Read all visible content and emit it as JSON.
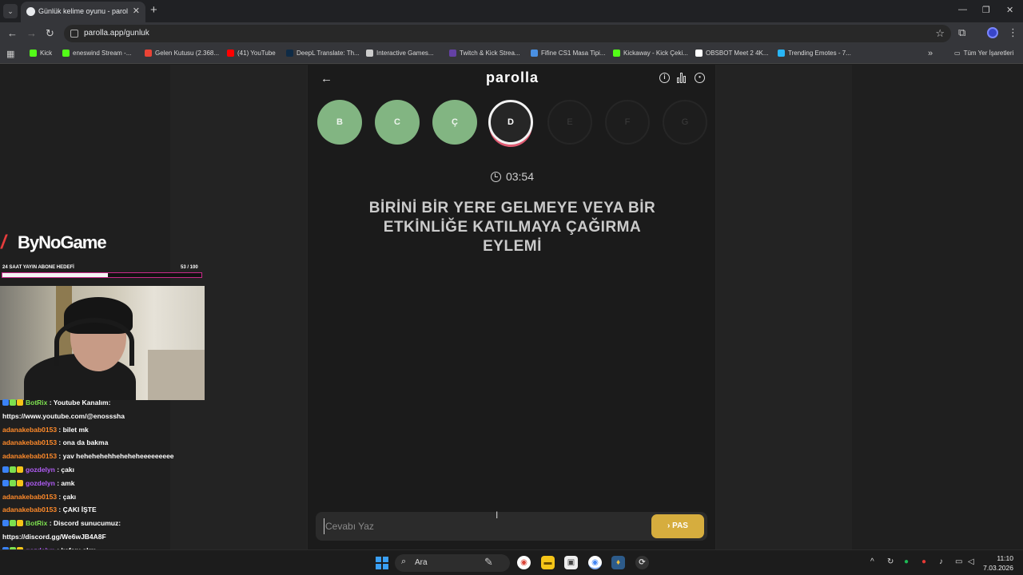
{
  "browser": {
    "tab_title": "Günlük kelime oyunu - parolla",
    "url": "parolla.app/gunluk",
    "bookmarks": [
      {
        "label": "Kick",
        "color": "#53fc18"
      },
      {
        "label": "eneswind Stream -...",
        "color": "#53fc18"
      },
      {
        "label": "Gelen Kutusu (2.368...",
        "color": "#ea4335"
      },
      {
        "label": "(41) YouTube",
        "color": "#ff0000"
      },
      {
        "label": "DeepL Translate: Th...",
        "color": "#0f2b46"
      },
      {
        "label": "Interactive Games...",
        "color": "#cccccc"
      },
      {
        "label": "Twitch & Kick Strea...",
        "color": "#6441a5"
      },
      {
        "label": "Fifine CS1 Masa Tipi...",
        "color": "#4a90e2"
      },
      {
        "label": "Kickaway - Kick Çeki...",
        "color": "#53fc18"
      },
      {
        "label": "OBSBOT Meet 2 4K...",
        "color": "#ffffff"
      },
      {
        "label": "Trending Emotes - 7...",
        "color": "#29b6f6"
      }
    ],
    "all_bookmarks": "Tüm Yer İşaretleri"
  },
  "game": {
    "logo": "parolla",
    "letters": [
      {
        "letter": "B",
        "state": "done"
      },
      {
        "letter": "C",
        "state": "done"
      },
      {
        "letter": "Ç",
        "state": "done"
      },
      {
        "letter": "D",
        "state": "current"
      },
      {
        "letter": "E",
        "state": "future"
      },
      {
        "letter": "F",
        "state": "future"
      },
      {
        "letter": "G",
        "state": "future"
      }
    ],
    "timer": "03:54",
    "question": "BİRİNİ BİR YERE GELMEYE VEYA BİR ETKİNLİĞE KATILMAYA ÇAĞIRMA EYLEMİ",
    "answer_placeholder": "Cevabı Yaz",
    "pass_label": "PAS"
  },
  "overlay": {
    "brand": "ByNoGame",
    "goal_label": "24 SAAT YAYIN ABONE HEDEFİ",
    "goal_count": "53 / 100",
    "goal_progress": 0.53,
    "chat": [
      {
        "user": "BotRix",
        "user_color": "green",
        "badges": true,
        "text": ": Youtube Kanalım:"
      },
      {
        "user": "",
        "user_color": "",
        "badges": false,
        "text": "https://www.youtube.com/@enosssha"
      },
      {
        "user": "adanakebab0153",
        "user_color": "orange",
        "badges": false,
        "text": ": bilet mk"
      },
      {
        "user": "adanakebab0153",
        "user_color": "orange",
        "badges": false,
        "text": ": ona da bakma"
      },
      {
        "user": "adanakebab0153",
        "user_color": "orange",
        "badges": false,
        "text": ": yav hehehehehheheheheeeeeeeee"
      },
      {
        "user": "gozdelyn",
        "user_color": "purple",
        "badges": true,
        "text": ": çakı"
      },
      {
        "user": "gozdelyn",
        "user_color": "purple",
        "badges": true,
        "text": ": amk"
      },
      {
        "user": "adanakebab0153",
        "user_color": "orange",
        "badges": false,
        "text": ": çakı"
      },
      {
        "user": "adanakebab0153",
        "user_color": "orange",
        "badges": false,
        "text": ": ÇAKI İŞTE"
      },
      {
        "user": "BotRix",
        "user_color": "green",
        "badges": true,
        "text": ": Discord sunucumuz:"
      },
      {
        "user": "",
        "user_color": "",
        "badges": false,
        "text": "https://discord.gg/We6wJB4A8F"
      },
      {
        "user": "gozdelyn",
        "user_color": "purple",
        "badges": true,
        "text": ": kafanı skm"
      }
    ]
  },
  "taskbar": {
    "search_label": "Ara",
    "time": "11:10",
    "date": "7.03.2026"
  }
}
